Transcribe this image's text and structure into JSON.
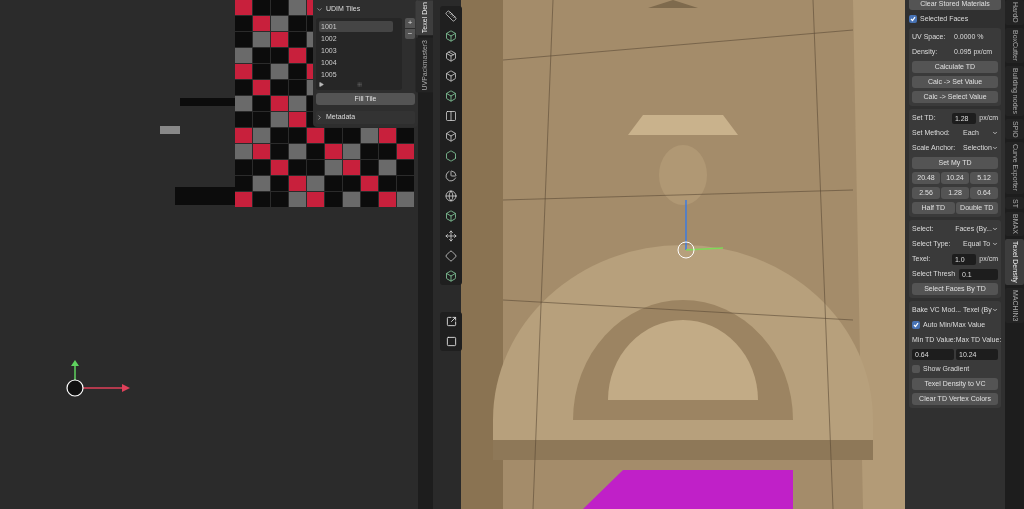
{
  "uv_editor": {
    "sidebar_tabs": [
      {
        "label": "Texel Den",
        "selected": true
      },
      {
        "label": "UVPackmaster3",
        "selected": false
      }
    ],
    "udim_panel": {
      "title": "UDIM Tiles",
      "expanded": true,
      "tiles": [
        {
          "label": "1001",
          "selected": true
        },
        {
          "label": "1002",
          "selected": false
        },
        {
          "label": "1003",
          "selected": false
        },
        {
          "label": "1004",
          "selected": false
        },
        {
          "label": "1005",
          "selected": false
        }
      ],
      "add_button": "+",
      "remove_button": "−",
      "fill_button": "Fill Tile"
    },
    "metadata_panel": {
      "title": "Metadata",
      "expanded": false
    }
  },
  "texel_panel": {
    "top_button": "Clear Stored Materials",
    "selected_faces": {
      "label": "Selected Faces",
      "checked": true
    },
    "boxes": [
      [
        {
          "kind": "info",
          "label": "UV Space:",
          "value": "0.0000 %"
        },
        {
          "kind": "info",
          "label": "Density:",
          "value": "0.095 px/cm"
        },
        {
          "kind": "button",
          "label": "Calculate TD"
        },
        {
          "kind": "button",
          "label": "Calc -> Set Value"
        },
        {
          "kind": "button",
          "label": "Calc -> Select Value"
        }
      ],
      [
        {
          "kind": "field",
          "label": "Set TD:",
          "value": "1.28",
          "unit": "px/cm"
        },
        {
          "kind": "dropdown",
          "label": "Set Method:",
          "value": "Each"
        },
        {
          "kind": "dropdown",
          "label": "Scale Anchor:",
          "value": "Selection"
        },
        {
          "kind": "button",
          "label": "Set My TD"
        },
        {
          "kind": "grid",
          "buttons": [
            "20.48",
            "10.24",
            "5.12"
          ]
        },
        {
          "kind": "grid",
          "buttons": [
            "2.56",
            "1.28",
            "0.64"
          ]
        },
        {
          "kind": "grid",
          "buttons": [
            "Half TD",
            "Double TD"
          ]
        }
      ],
      [
        {
          "kind": "dropdown",
          "label": "Select:",
          "value": "Faces (By..."
        },
        {
          "kind": "dropdown",
          "label": "Select Type:",
          "value": "Equal To"
        },
        {
          "kind": "field",
          "label": "Texel:",
          "value": "1.0",
          "unit": "px/cm"
        },
        {
          "kind": "field",
          "label": "Select Thresh",
          "value": "0.1"
        },
        {
          "kind": "button",
          "label": "Select Faces By TD"
        }
      ],
      [
        {
          "kind": "dropdown",
          "label": "Bake VC Mod...",
          "value": "Texel (By"
        },
        {
          "kind": "checkbox",
          "label": "Auto Min/Max Value",
          "checked": true
        },
        {
          "kind": "labels",
          "labels": [
            "Min TD Value:",
            "Max TD Value:"
          ]
        },
        {
          "kind": "fields",
          "values": [
            "0.64",
            "10.24"
          ]
        },
        {
          "kind": "checkbox",
          "label": "Show Gradient",
          "checked": false
        },
        {
          "kind": "button",
          "label": "Texel Density to VC"
        },
        {
          "kind": "button",
          "label": "Clear TD Vertex Colors"
        }
      ]
    ]
  },
  "sidebar_tabs": [
    {
      "label": "HardO",
      "selected": false
    },
    {
      "label": "BoxCutter",
      "selected": false
    },
    {
      "label": "Building nodes",
      "selected": false
    },
    {
      "label": "SPIO",
      "selected": false
    },
    {
      "label": "Curve Exporter",
      "selected": false
    },
    {
      "label": "ST",
      "selected": false
    },
    {
      "label": "BMAX",
      "selected": false
    },
    {
      "label": "Texel Density",
      "selected": true
    },
    {
      "label": "MACHIN3",
      "selected": false
    }
  ]
}
